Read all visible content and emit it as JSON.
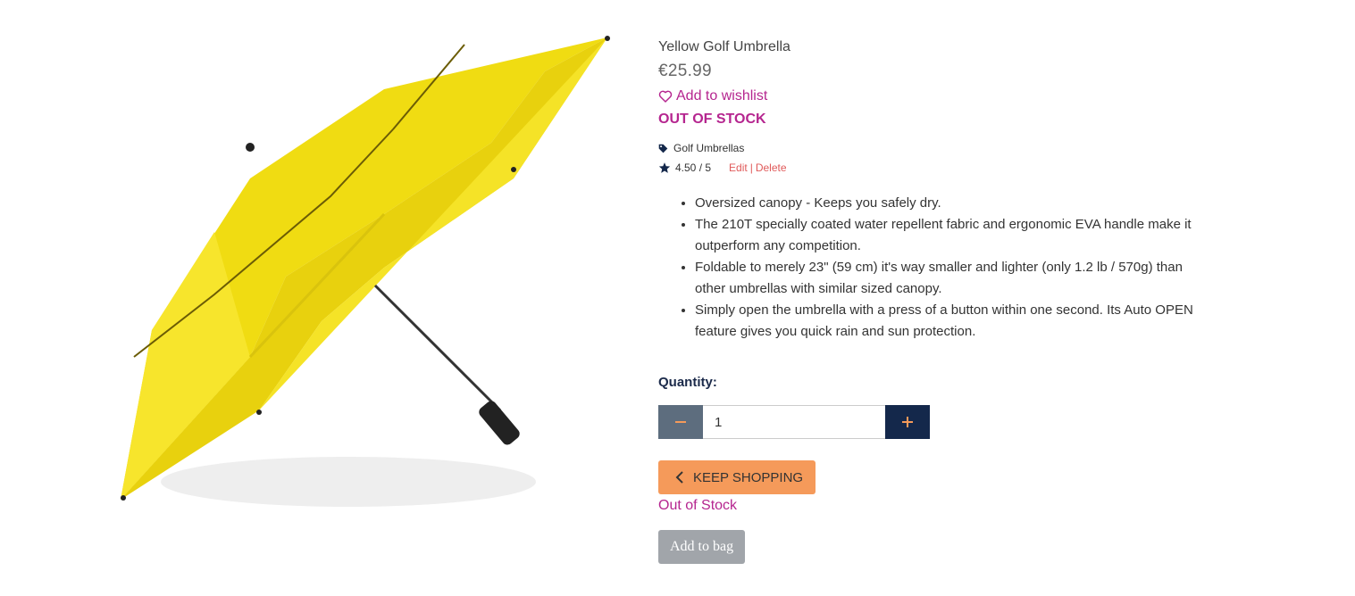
{
  "product": {
    "image_alt": "Yellow Golf Umbrella",
    "title": "Yellow Golf Umbrella",
    "price": "€25.99",
    "wishlist_label": "Add to wishlist",
    "stock_badge": "OUT OF STOCK",
    "category": "Golf Umbrellas",
    "rating": "4.50 / 5",
    "edit_label": "Edit",
    "separator": "|",
    "delete_label": "Delete",
    "features": [
      "Oversized canopy - Keeps you safely dry.",
      "The 210T specially coated water repellent fabric and ergonomic EVA handle make it outperform any competition.",
      "Foldable to merely 23\" (59 cm) it's way smaller and lighter (only 1.2 lb / 570g) than other umbrellas with similar sized canopy.",
      "Simply open the umbrella with a press of a button within one second. Its Auto OPEN feature gives you quick rain and sun protection."
    ]
  },
  "quantity": {
    "label": "Quantity:",
    "value": "1"
  },
  "actions": {
    "keep_shopping": "KEEP SHOPPING",
    "out_of_stock": "Out of Stock",
    "add_to_bag": "Add to bag"
  },
  "colors": {
    "accent": "#b5258f",
    "keep_shopping_bg": "#f59a5a",
    "qty_minus_bg": "#5d6d7e",
    "qty_plus_bg": "#14284b",
    "add_to_bag_bg": "#a1a5aa",
    "umbrella": "#f5e21a"
  }
}
